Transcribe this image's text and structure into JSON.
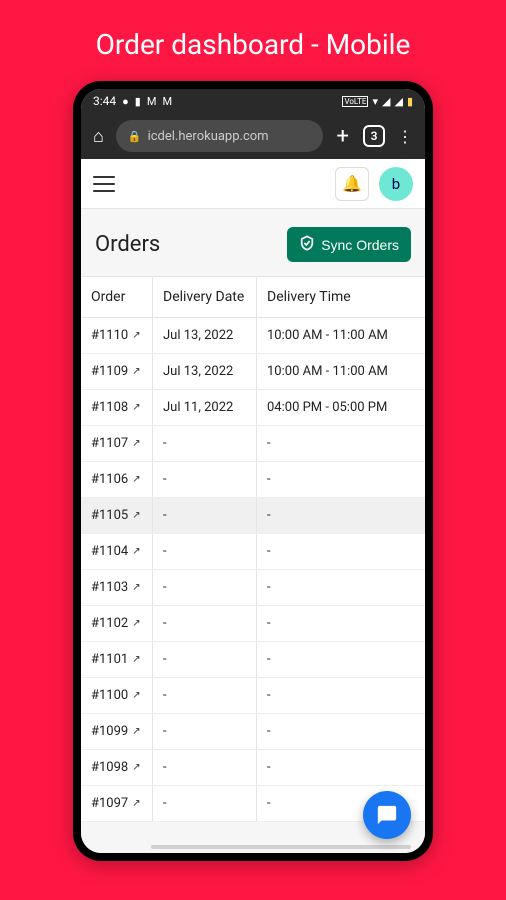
{
  "page": {
    "title": "Order dashboard - Mobile"
  },
  "status_bar": {
    "time": "3:44",
    "right_icons": {
      "volte": "VoLTE",
      "battery": "▮"
    }
  },
  "browser": {
    "url": "icdel.herokuapp.com",
    "tabs_count": "3"
  },
  "app_header": {
    "avatar_initial": "b"
  },
  "main": {
    "title": "Orders",
    "sync_label": "Sync Orders",
    "columns": {
      "order": "Order",
      "date": "Delivery Date",
      "time": "Delivery Time"
    },
    "rows": [
      {
        "order": "#1110",
        "date": "Jul 13, 2022",
        "time": "10:00 AM - 11:00 AM",
        "selected": false
      },
      {
        "order": "#1109",
        "date": "Jul 13, 2022",
        "time": "10:00 AM - 11:00 AM",
        "selected": false
      },
      {
        "order": "#1108",
        "date": "Jul 11, 2022",
        "time": "04:00 PM - 05:00 PM",
        "selected": false
      },
      {
        "order": "#1107",
        "date": "-",
        "time": "-",
        "selected": false
      },
      {
        "order": "#1106",
        "date": "-",
        "time": "-",
        "selected": false
      },
      {
        "order": "#1105",
        "date": "-",
        "time": "-",
        "selected": true
      },
      {
        "order": "#1104",
        "date": "-",
        "time": "-",
        "selected": false
      },
      {
        "order": "#1103",
        "date": "-",
        "time": "-",
        "selected": false
      },
      {
        "order": "#1102",
        "date": "-",
        "time": "-",
        "selected": false
      },
      {
        "order": "#1101",
        "date": "-",
        "time": "-",
        "selected": false
      },
      {
        "order": "#1100",
        "date": "-",
        "time": "-",
        "selected": false
      },
      {
        "order": "#1099",
        "date": "-",
        "time": "-",
        "selected": false
      },
      {
        "order": "#1098",
        "date": "-",
        "time": "-",
        "selected": false
      },
      {
        "order": "#1097",
        "date": "-",
        "time": "-",
        "selected": false
      }
    ]
  }
}
